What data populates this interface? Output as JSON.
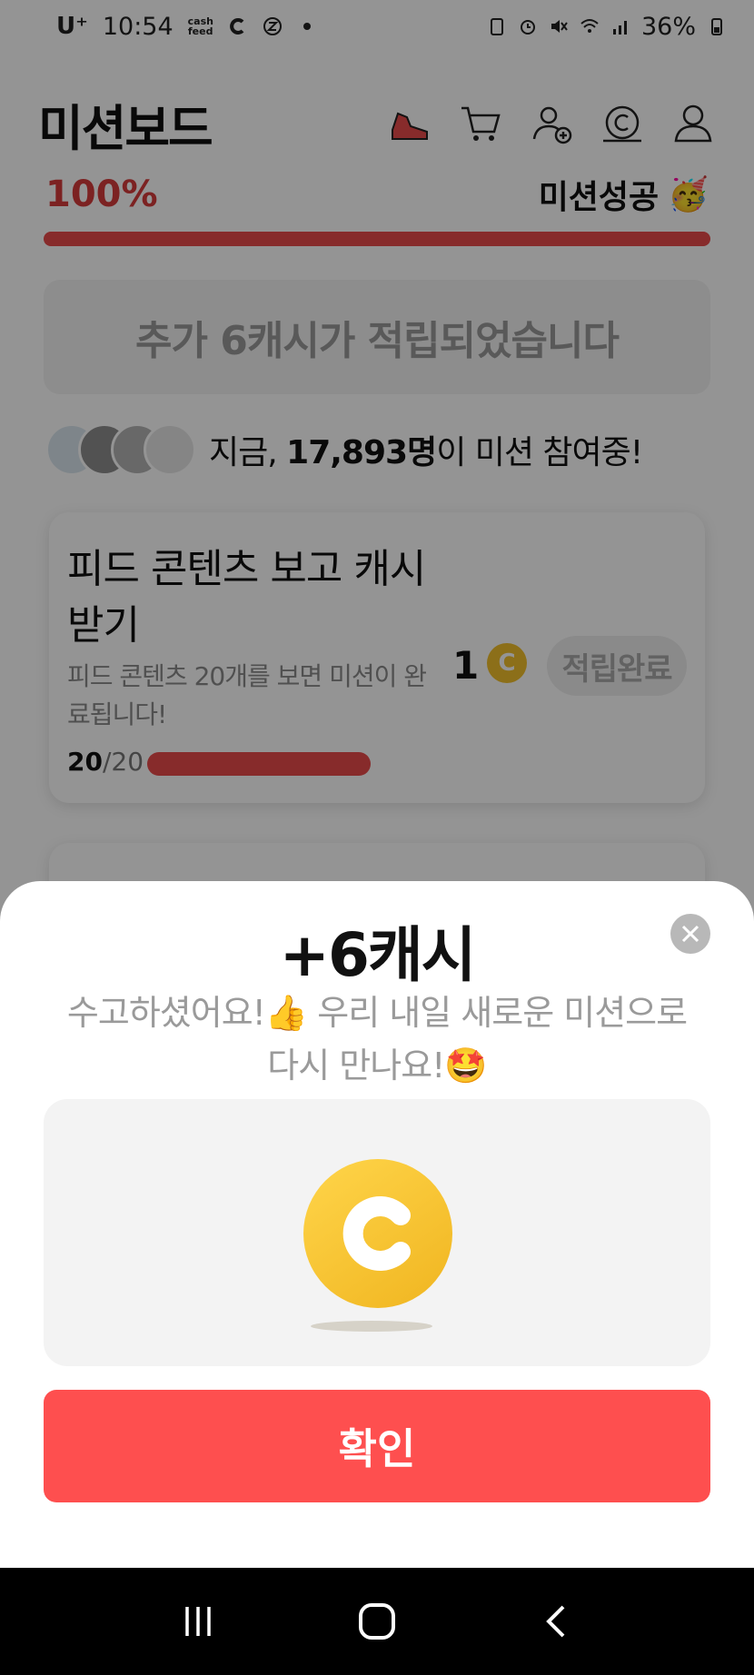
{
  "status_bar": {
    "carrier": "U⁺",
    "time": "10:54",
    "cashfeed_label": "cash feed",
    "battery": "36%",
    "icons": [
      "c-app-icon",
      "z-app-icon",
      "dot-icon",
      "battery-saver-icon",
      "alarm-icon",
      "mute-icon",
      "wifi-icon",
      "signal-icon",
      "battery-icon"
    ]
  },
  "header": {
    "title": "미션보드",
    "icons": [
      "sneaker-icon",
      "cart-icon",
      "add-friend-icon",
      "cash-coin-icon",
      "profile-icon"
    ]
  },
  "progress": {
    "percent_label": "100%",
    "value": 1.0,
    "status_label": "미션성공",
    "status_emoji": "🥳",
    "bar_color": "#e84a4a"
  },
  "notice": {
    "text": "추가 6캐시가 적립되었습니다"
  },
  "participants": {
    "prefix": "지금, ",
    "count": "17,893명",
    "suffix": "이 미션 참여중!"
  },
  "mission": {
    "title": "피드 콘텐츠 보고 캐시 받기",
    "description": "피드 콘텐츠 20개를 보면 미션이 완료됩니다!",
    "progress_current": "20",
    "progress_total": "/20",
    "progress_value": 1.0,
    "reward_amount": "1",
    "coin_letter": "C",
    "status_button": "적립완료"
  },
  "sheet": {
    "title": "+6캐시",
    "message": "수고하셨어요!👍 우리 내일 새로운 미션으로 다시 만나요!🤩",
    "coin_icon": "cash-coin-icon",
    "confirm_label": "확인",
    "accent_color": "#fe4f4f",
    "coin_color": "#f2c02c"
  },
  "nav_bar": {
    "buttons": [
      "recent-apps-icon",
      "home-icon",
      "back-icon"
    ]
  }
}
